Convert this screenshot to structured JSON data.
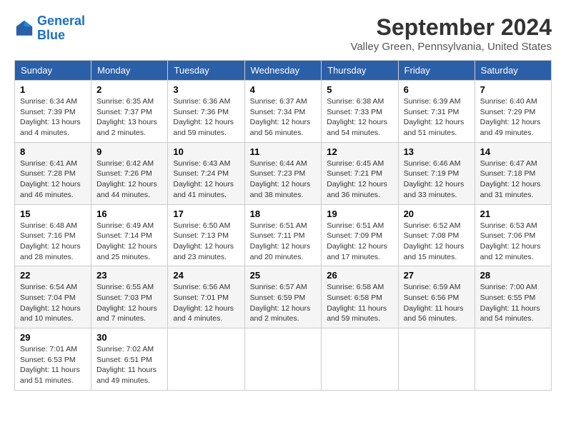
{
  "logo": {
    "line1": "General",
    "line2": "Blue"
  },
  "title": "September 2024",
  "location": "Valley Green, Pennsylvania, United States",
  "weekdays": [
    "Sunday",
    "Monday",
    "Tuesday",
    "Wednesday",
    "Thursday",
    "Friday",
    "Saturday"
  ],
  "weeks": [
    [
      {
        "day": "1",
        "info": "Sunrise: 6:34 AM\nSunset: 7:39 PM\nDaylight: 13 hours\nand 4 minutes."
      },
      {
        "day": "2",
        "info": "Sunrise: 6:35 AM\nSunset: 7:37 PM\nDaylight: 13 hours\nand 2 minutes."
      },
      {
        "day": "3",
        "info": "Sunrise: 6:36 AM\nSunset: 7:36 PM\nDaylight: 12 hours\nand 59 minutes."
      },
      {
        "day": "4",
        "info": "Sunrise: 6:37 AM\nSunset: 7:34 PM\nDaylight: 12 hours\nand 56 minutes."
      },
      {
        "day": "5",
        "info": "Sunrise: 6:38 AM\nSunset: 7:33 PM\nDaylight: 12 hours\nand 54 minutes."
      },
      {
        "day": "6",
        "info": "Sunrise: 6:39 AM\nSunset: 7:31 PM\nDaylight: 12 hours\nand 51 minutes."
      },
      {
        "day": "7",
        "info": "Sunrise: 6:40 AM\nSunset: 7:29 PM\nDaylight: 12 hours\nand 49 minutes."
      }
    ],
    [
      {
        "day": "8",
        "info": "Sunrise: 6:41 AM\nSunset: 7:28 PM\nDaylight: 12 hours\nand 46 minutes."
      },
      {
        "day": "9",
        "info": "Sunrise: 6:42 AM\nSunset: 7:26 PM\nDaylight: 12 hours\nand 44 minutes."
      },
      {
        "day": "10",
        "info": "Sunrise: 6:43 AM\nSunset: 7:24 PM\nDaylight: 12 hours\nand 41 minutes."
      },
      {
        "day": "11",
        "info": "Sunrise: 6:44 AM\nSunset: 7:23 PM\nDaylight: 12 hours\nand 38 minutes."
      },
      {
        "day": "12",
        "info": "Sunrise: 6:45 AM\nSunset: 7:21 PM\nDaylight: 12 hours\nand 36 minutes."
      },
      {
        "day": "13",
        "info": "Sunrise: 6:46 AM\nSunset: 7:19 PM\nDaylight: 12 hours\nand 33 minutes."
      },
      {
        "day": "14",
        "info": "Sunrise: 6:47 AM\nSunset: 7:18 PM\nDaylight: 12 hours\nand 31 minutes."
      }
    ],
    [
      {
        "day": "15",
        "info": "Sunrise: 6:48 AM\nSunset: 7:16 PM\nDaylight: 12 hours\nand 28 minutes."
      },
      {
        "day": "16",
        "info": "Sunrise: 6:49 AM\nSunset: 7:14 PM\nDaylight: 12 hours\nand 25 minutes."
      },
      {
        "day": "17",
        "info": "Sunrise: 6:50 AM\nSunset: 7:13 PM\nDaylight: 12 hours\nand 23 minutes."
      },
      {
        "day": "18",
        "info": "Sunrise: 6:51 AM\nSunset: 7:11 PM\nDaylight: 12 hours\nand 20 minutes."
      },
      {
        "day": "19",
        "info": "Sunrise: 6:51 AM\nSunset: 7:09 PM\nDaylight: 12 hours\nand 17 minutes."
      },
      {
        "day": "20",
        "info": "Sunrise: 6:52 AM\nSunset: 7:08 PM\nDaylight: 12 hours\nand 15 minutes."
      },
      {
        "day": "21",
        "info": "Sunrise: 6:53 AM\nSunset: 7:06 PM\nDaylight: 12 hours\nand 12 minutes."
      }
    ],
    [
      {
        "day": "22",
        "info": "Sunrise: 6:54 AM\nSunset: 7:04 PM\nDaylight: 12 hours\nand 10 minutes."
      },
      {
        "day": "23",
        "info": "Sunrise: 6:55 AM\nSunset: 7:03 PM\nDaylight: 12 hours\nand 7 minutes."
      },
      {
        "day": "24",
        "info": "Sunrise: 6:56 AM\nSunset: 7:01 PM\nDaylight: 12 hours\nand 4 minutes."
      },
      {
        "day": "25",
        "info": "Sunrise: 6:57 AM\nSunset: 6:59 PM\nDaylight: 12 hours\nand 2 minutes."
      },
      {
        "day": "26",
        "info": "Sunrise: 6:58 AM\nSunset: 6:58 PM\nDaylight: 11 hours\nand 59 minutes."
      },
      {
        "day": "27",
        "info": "Sunrise: 6:59 AM\nSunset: 6:56 PM\nDaylight: 11 hours\nand 56 minutes."
      },
      {
        "day": "28",
        "info": "Sunrise: 7:00 AM\nSunset: 6:55 PM\nDaylight: 11 hours\nand 54 minutes."
      }
    ],
    [
      {
        "day": "29",
        "info": "Sunrise: 7:01 AM\nSunset: 6:53 PM\nDaylight: 11 hours\nand 51 minutes."
      },
      {
        "day": "30",
        "info": "Sunrise: 7:02 AM\nSunset: 6:51 PM\nDaylight: 11 hours\nand 49 minutes."
      },
      {
        "day": "",
        "info": ""
      },
      {
        "day": "",
        "info": ""
      },
      {
        "day": "",
        "info": ""
      },
      {
        "day": "",
        "info": ""
      },
      {
        "day": "",
        "info": ""
      }
    ]
  ]
}
